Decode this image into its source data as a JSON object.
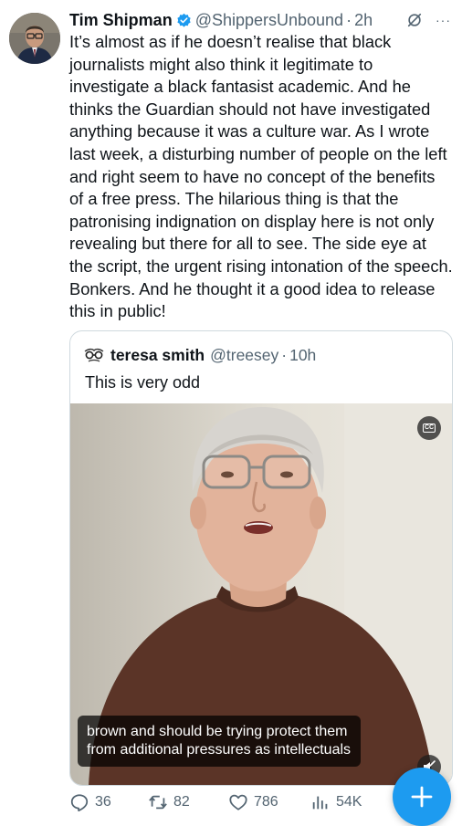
{
  "tweet": {
    "author_name": "Tim Shipman",
    "handle": "@ShippersUnbound",
    "separator": "·",
    "time": "2h",
    "text": "It’s almost as if he doesn’t realise that black journalists might also think it legitimate to investigate a black fantasist academic. And he thinks the Guardian should not have investigated anything because it was a culture war. As I wrote last week, a disturbing number of people on the left and right seem to have no concept of the benefits of a free press. The hilarious thing is that the patronising indignation on display here is not only revealing but there for all to see. The side eye at the script, the urgent rising intonation of the speech. Bonkers. And he thought it a good idea to release this in public!",
    "more_icon": "···"
  },
  "quote": {
    "author_name": "teresa smith",
    "handle": "@treesey",
    "separator": "·",
    "time": "10h",
    "text": "This is very odd",
    "video": {
      "cc_label": "CC",
      "caption": "brown and should be trying protect them from additional pressures as intellectuals"
    }
  },
  "actions": {
    "replies": "36",
    "reposts": "82",
    "likes": "786",
    "views": "54K"
  },
  "fab": {
    "label": "+"
  },
  "colors": {
    "accent": "#1d9bf0",
    "text": "#0f1419",
    "muted": "#536471",
    "border": "#cfd9de"
  },
  "icons": {
    "reply": "reply-icon",
    "repost": "repost-icon",
    "like": "heart-icon",
    "views": "views-icon",
    "verified": "verified-badge-icon",
    "grok": "grok-icon",
    "compose": "plus-icon"
  }
}
